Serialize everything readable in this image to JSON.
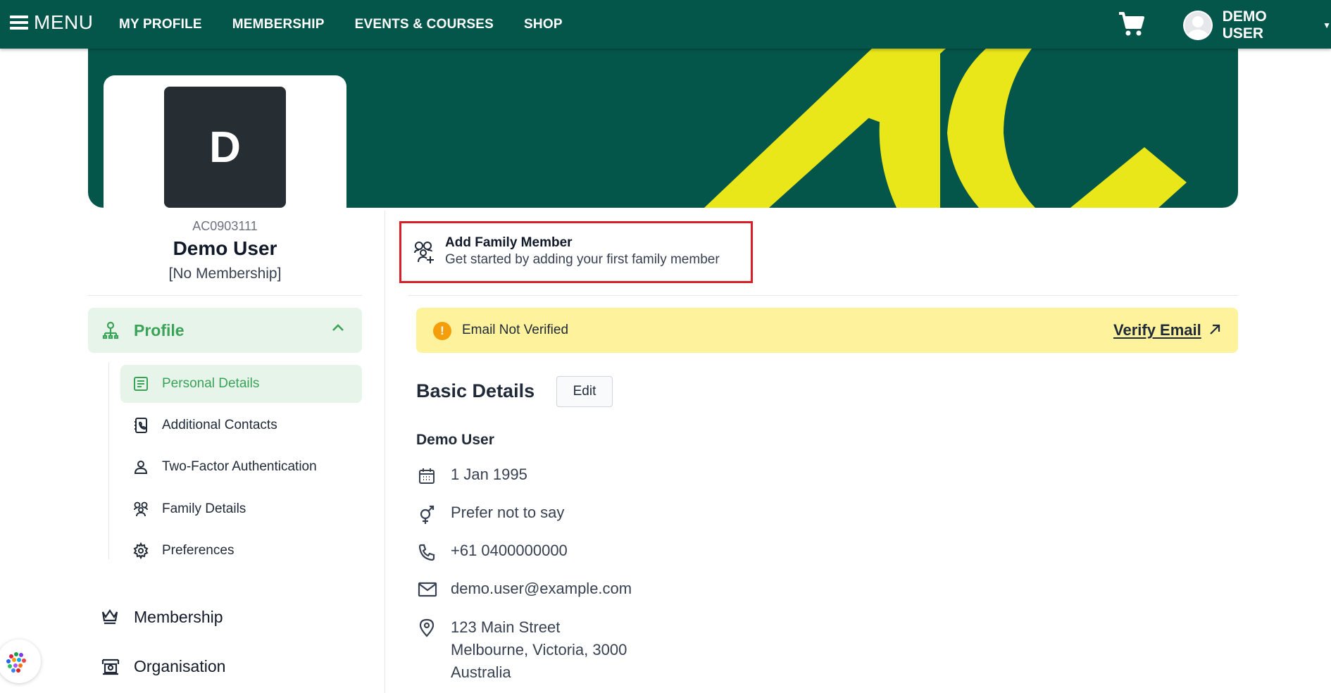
{
  "topbar": {
    "menu_label": "MENU",
    "nav": [
      "MY PROFILE",
      "MEMBERSHIP",
      "EVENTS & COURSES",
      "SHOP"
    ],
    "user_label": "DEMO USER",
    "bg_color": "#04564a"
  },
  "profile": {
    "initial": "D",
    "member_id": "AC0903111",
    "name": "Demo User",
    "status": "[No Membership]"
  },
  "sidebar": {
    "profile_label": "Profile",
    "sub_items": [
      {
        "label": "Personal Details",
        "icon": "document-list-icon",
        "active": true
      },
      {
        "label": "Additional Contacts",
        "icon": "contact-book-icon"
      },
      {
        "label": "Two-Factor Authentication",
        "icon": "person-icon"
      },
      {
        "label": "Family Details",
        "icon": "family-icon"
      },
      {
        "label": "Preferences",
        "icon": "gear-icon"
      }
    ],
    "membership_label": "Membership",
    "organisation_label": "Organisation",
    "accent_color": "#3aa357"
  },
  "family_prompt": {
    "title": "Add Family Member",
    "subtitle": "Get started by adding your first family member",
    "highlight_color": "#d61f26"
  },
  "alert": {
    "message": "Email Not Verified",
    "action": "Verify Email",
    "bg_color": "#fef39c"
  },
  "basic_details": {
    "title": "Basic Details",
    "edit_label": "Edit",
    "name": "Demo User",
    "dob": "1 Jan 1995",
    "gender": "Prefer not to say",
    "phone": "+61 0400000000",
    "email": "demo.user@example.com",
    "address_line1": "123 Main Street",
    "address_line2": "Melbourne, Victoria, 3000",
    "address_line3": "Australia"
  }
}
